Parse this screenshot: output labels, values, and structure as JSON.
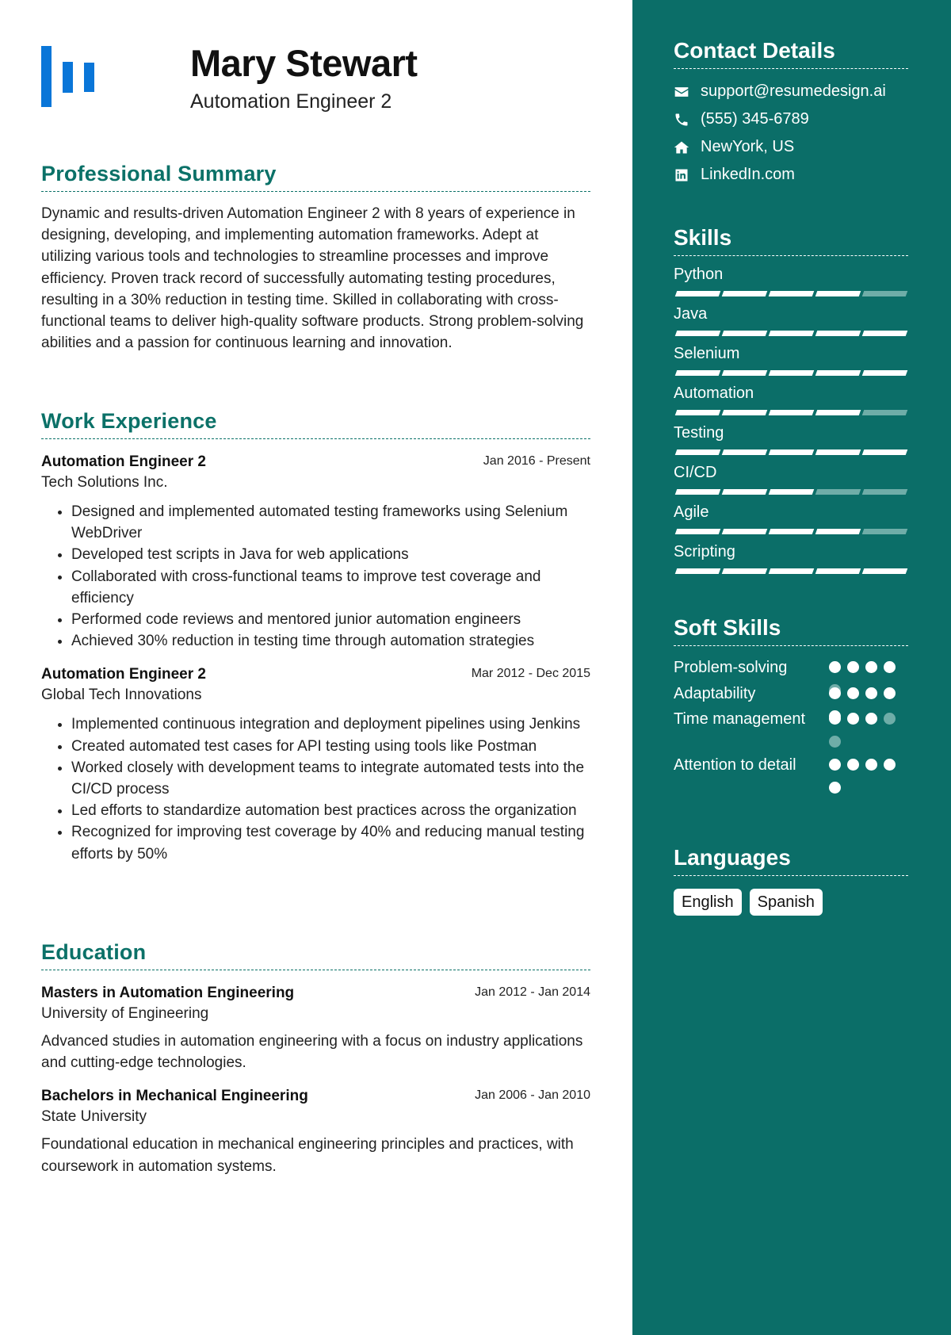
{
  "header": {
    "name": "Mary Stewart",
    "role": "Automation Engineer 2",
    "logo_color": "#0a76d8"
  },
  "theme": {
    "sidebar_bg": "#0b6e68",
    "heading_color": "#0b7168",
    "inactive_color": "#6fada8"
  },
  "summary": {
    "title": "Professional Summary",
    "text": "Dynamic and results-driven Automation Engineer 2 with 8 years of experience in designing, developing, and implementing automation frameworks. Adept at utilizing various tools and technologies to streamline processes and improve efficiency. Proven track record of successfully automating testing procedures, resulting in a 30% reduction in testing time. Skilled in collaborating with cross-functional teams to deliver high-quality software products. Strong problem-solving abilities and a passion for continuous learning and innovation."
  },
  "experience": {
    "title": "Work Experience",
    "jobs": [
      {
        "title": "Automation Engineer 2",
        "date": "Jan 2016 - Present",
        "company": "Tech Solutions Inc.",
        "bullets": [
          "Designed and implemented automated testing frameworks using Selenium WebDriver",
          "Developed test scripts in Java for web applications",
          "Collaborated with cross-functional teams to improve test coverage and efficiency",
          "Performed code reviews and mentored junior automation engineers",
          "Achieved 30% reduction in testing time through automation strategies"
        ]
      },
      {
        "title": "Automation Engineer 2",
        "date": "Mar 2012 - Dec 2015",
        "company": "Global Tech Innovations",
        "bullets": [
          "Implemented continuous integration and deployment pipelines using Jenkins",
          "Created automated test cases for API testing using tools like Postman",
          "Worked closely with development teams to integrate automated tests into the CI/CD process",
          "Led efforts to standardize automation best practices across the organization",
          "Recognized for improving test coverage by 40% and reducing manual testing efforts by 50%"
        ]
      }
    ]
  },
  "education": {
    "title": "Education",
    "items": [
      {
        "degree": "Masters in Automation Engineering",
        "date": "Jan 2012 - Jan 2014",
        "school": "University of Engineering",
        "description": "Advanced studies in automation engineering with a focus on industry applications and cutting-edge technologies."
      },
      {
        "degree": "Bachelors in Mechanical Engineering",
        "date": "Jan 2006 - Jan 2010",
        "school": "State University",
        "description": "Foundational education in mechanical engineering principles and practices, with coursework in automation systems."
      }
    ]
  },
  "contact": {
    "title": "Contact Details",
    "items": [
      {
        "icon": "envelope-icon",
        "text": "support@resumedesign.ai"
      },
      {
        "icon": "phone-icon",
        "text": "(555) 345-6789"
      },
      {
        "icon": "home-icon",
        "text": "NewYork, US"
      },
      {
        "icon": "linkedin-icon",
        "text": "LinkedIn.com"
      }
    ]
  },
  "skills": {
    "title": "Skills",
    "max": 5,
    "items": [
      {
        "name": "Python",
        "level": 4
      },
      {
        "name": "Java",
        "level": 5
      },
      {
        "name": "Selenium",
        "level": 5
      },
      {
        "name": "Automation",
        "level": 4
      },
      {
        "name": "Testing",
        "level": 5
      },
      {
        "name": "CI/CD",
        "level": 3
      },
      {
        "name": "Agile",
        "level": 4
      },
      {
        "name": "Scripting",
        "level": 5
      }
    ]
  },
  "soft_skills": {
    "title": "Soft Skills",
    "max": 5,
    "items": [
      {
        "name": "Problem-solving",
        "level": 4
      },
      {
        "name": "Adaptability",
        "level": 5
      },
      {
        "name": "Time management",
        "level": 3
      },
      {
        "name": "Attention to detail",
        "level": 5
      }
    ]
  },
  "languages": {
    "title": "Languages",
    "items": [
      "English",
      "Spanish"
    ]
  }
}
